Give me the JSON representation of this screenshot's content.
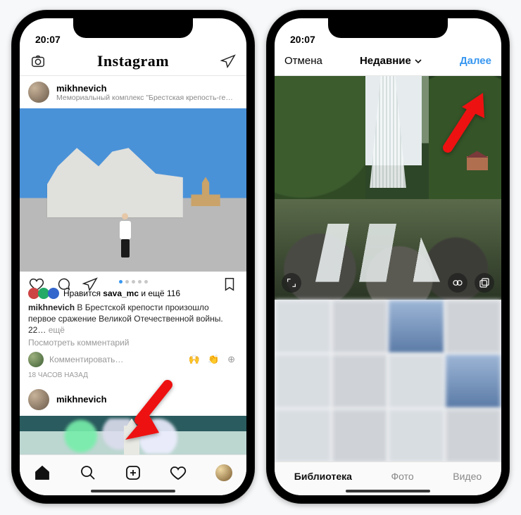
{
  "status": {
    "time": "20:07"
  },
  "feed": {
    "brand": "Instagram",
    "post": {
      "user": "mikhnevich",
      "location": "Мемориальный комплекс \"Брестская крепость-ге…",
      "likes_prefix": "Нравится ",
      "likes_user": "sava_mc",
      "likes_suffix": " и ещё 116",
      "caption_text": "В Брестской крепости произошло первое сражение Великой Отечественной войны. 22…",
      "more": " ещё",
      "view_comments": "Посмотреть комментарий",
      "add_comment_placeholder": "Комментировать…",
      "timestamp": "18 часов назад"
    },
    "post2": {
      "user": "mikhnevich"
    }
  },
  "picker": {
    "cancel": "Отмена",
    "title": "Недавние",
    "next": "Далее",
    "tabs": {
      "library": "Библиотека",
      "photo": "Фото",
      "video": "Видео"
    }
  }
}
